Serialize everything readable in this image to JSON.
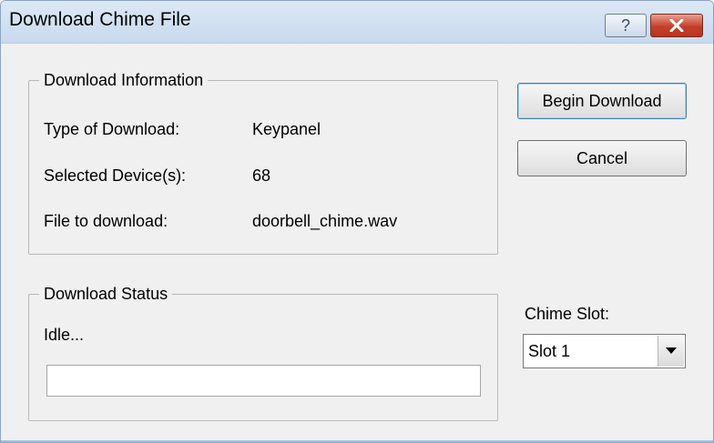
{
  "window": {
    "title": "Download Chime File",
    "help_glyph": "?",
    "close_icon": "close-icon"
  },
  "download_info": {
    "legend": "Download Information",
    "rows": [
      {
        "label": "Type of Download:",
        "value": "Keypanel"
      },
      {
        "label": "Selected Device(s):",
        "value": "68"
      },
      {
        "label": "File to download:",
        "value": "doorbell_chime.wav"
      }
    ]
  },
  "download_status": {
    "legend": "Download Status",
    "status_text": "Idle...",
    "progress": 0
  },
  "buttons": {
    "begin_label": "Begin Download",
    "cancel_label": "Cancel"
  },
  "chime_slot": {
    "label": "Chime Slot:",
    "selected": "Slot 1"
  }
}
